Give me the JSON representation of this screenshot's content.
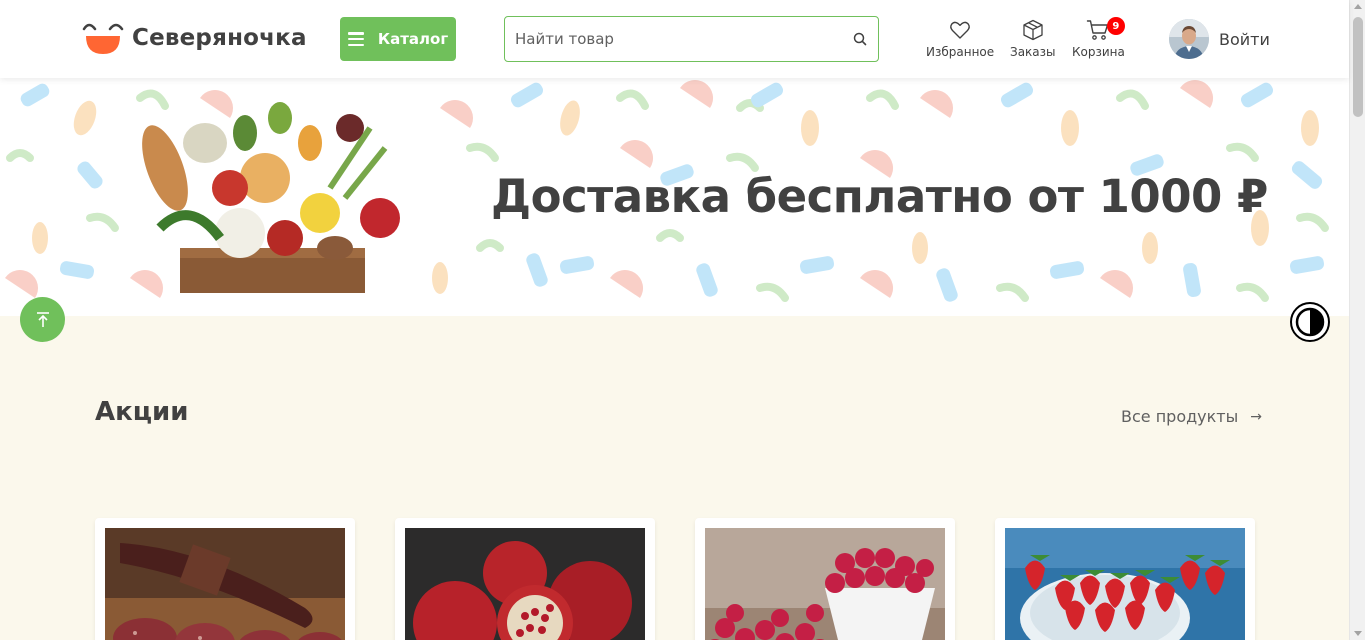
{
  "header": {
    "brand": "Северяночка",
    "catalog_label": "Каталог",
    "search_placeholder": "Найти товар",
    "favorites_label": "Избранное",
    "orders_label": "Заказы",
    "cart_label": "Корзина",
    "cart_count": "9",
    "login_label": "Войти"
  },
  "banner": {
    "title": "Доставка бесплатно от 1000 ₽"
  },
  "promo": {
    "title": "Акции",
    "all_link": "Все продукты",
    "all_arrow": "→",
    "products": [
      {
        "icon": "sausage-photo"
      },
      {
        "icon": "pomegranate-photo"
      },
      {
        "icon": "raspberry-photo"
      },
      {
        "icon": "strawberry-photo"
      }
    ]
  },
  "colors": {
    "accent": "#70C05B",
    "text": "#414141",
    "badge": "#FF0000",
    "page_bg": "#FBF8EC"
  }
}
